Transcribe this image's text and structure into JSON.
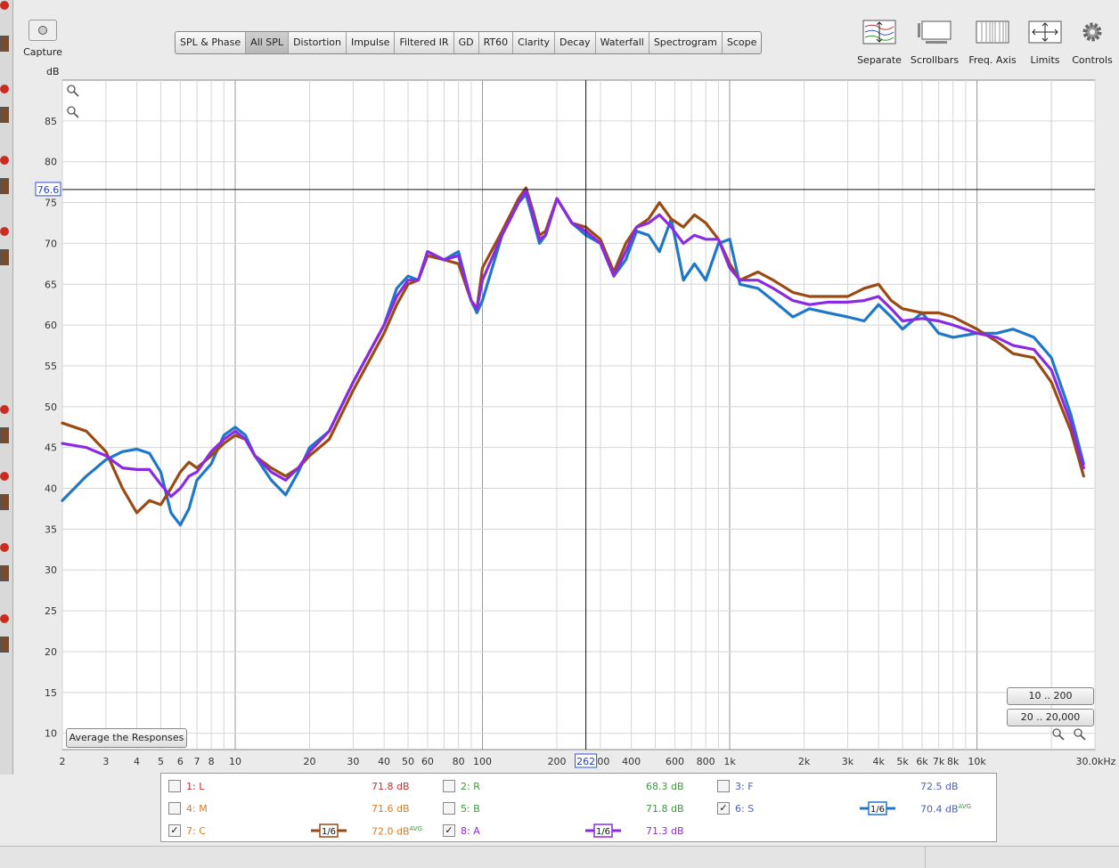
{
  "toolbar": {
    "capture_label": "Capture",
    "tabs": [
      "SPL & Phase",
      "All SPL",
      "Distortion",
      "Impulse",
      "Filtered IR",
      "GD",
      "RT60",
      "Clarity",
      "Decay",
      "Waterfall",
      "Spectrogram",
      "Scope"
    ],
    "active_tab": "All SPL",
    "tools": [
      "Separate",
      "Scrollbars",
      "Freq. Axis",
      "Limits",
      "Controls"
    ]
  },
  "y_unit": "dB",
  "cursor": {
    "freq_label": "262",
    "db_label": "76.6"
  },
  "buttons": {
    "average": "Average the Responses",
    "range1": "10 .. 200",
    "range2": "20 .. 20,000"
  },
  "legend": [
    {
      "id": "1: L",
      "value": "71.8 dB",
      "avg": "",
      "checked": false,
      "name_color": "#c83232",
      "smoothing": ""
    },
    {
      "id": "2: R",
      "value": "68.3 dB",
      "avg": "",
      "checked": false,
      "name_color": "#3a9a3a",
      "smoothing": ""
    },
    {
      "id": "3: F",
      "value": "72.5 dB",
      "avg": "",
      "checked": false,
      "name_color": "#5060c0",
      "smoothing": ""
    },
    {
      "id": "4: M",
      "value": "71.6 dB",
      "avg": "",
      "checked": false,
      "name_color": "#e07a20",
      "smoothing": ""
    },
    {
      "id": "5: B",
      "value": "71.8 dB",
      "avg": "",
      "checked": false,
      "name_color": "#3a9a3a",
      "smoothing": ""
    },
    {
      "id": "6: S",
      "value": "70.4 dB",
      "avg": "AVG",
      "checked": true,
      "name_color": "#5060c0",
      "smoothing": "1/6"
    },
    {
      "id": "7: C",
      "value": "72.0 dB",
      "avg": "AVG",
      "checked": true,
      "name_color": "#e07a20",
      "smoothing": "1/6"
    },
    {
      "id": "8: A",
      "value": "71.3 dB",
      "avg": "",
      "checked": true,
      "name_color": "#8a2be2",
      "smoothing": "1/6"
    }
  ],
  "chart_data": {
    "type": "line",
    "xscale": "log",
    "xlim": [
      2,
      30000
    ],
    "ylim": [
      8,
      90
    ],
    "grid": true,
    "x_ticks": [
      2,
      3,
      4,
      5,
      6,
      7,
      8,
      10,
      20,
      30,
      40,
      50,
      60,
      80,
      100,
      200,
      300,
      400,
      600,
      800,
      1000,
      2000,
      3000,
      4000,
      5000,
      6000,
      7000,
      8000,
      10000,
      30000
    ],
    "x_tick_labels": [
      "2",
      "3",
      "4",
      "5",
      "6",
      "7",
      "8",
      "10",
      "20",
      "30",
      "40",
      "50",
      "60",
      "80",
      "100",
      "200",
      "300",
      "400",
      "600",
      "800",
      "1k",
      "2k",
      "3k",
      "4k",
      "5k",
      "6k",
      "7k",
      "8k",
      "10k",
      "30.0kHz"
    ],
    "y_ticks": [
      10,
      15,
      20,
      25,
      30,
      35,
      40,
      45,
      50,
      55,
      60,
      65,
      70,
      75,
      80,
      85
    ],
    "cursor": {
      "x": 262,
      "y": 76.6
    },
    "series": [
      {
        "name": "6: S",
        "color": "#1f77c8",
        "points": [
          [
            2,
            38.5
          ],
          [
            2.5,
            41.5
          ],
          [
            3,
            43.5
          ],
          [
            3.5,
            44.5
          ],
          [
            4,
            44.8
          ],
          [
            4.5,
            44.3
          ],
          [
            5,
            42
          ],
          [
            5.5,
            37
          ],
          [
            6,
            35.5
          ],
          [
            6.5,
            37.5
          ],
          [
            7,
            41
          ],
          [
            8,
            43
          ],
          [
            9,
            46.5
          ],
          [
            10,
            47.5
          ],
          [
            11,
            46.5
          ],
          [
            12,
            44
          ],
          [
            14,
            41
          ],
          [
            16,
            39.2
          ],
          [
            18,
            42
          ],
          [
            20,
            45
          ],
          [
            24,
            47
          ],
          [
            30,
            53
          ],
          [
            40,
            60
          ],
          [
            45,
            64.5
          ],
          [
            50,
            66
          ],
          [
            55,
            65.5
          ],
          [
            60,
            69
          ],
          [
            70,
            68
          ],
          [
            80,
            69
          ],
          [
            90,
            63
          ],
          [
            95,
            61.5
          ],
          [
            100,
            63
          ],
          [
            120,
            71
          ],
          [
            140,
            75
          ],
          [
            150,
            76
          ],
          [
            160,
            73
          ],
          [
            170,
            70
          ],
          [
            180,
            71
          ],
          [
            200,
            75.5
          ],
          [
            230,
            72.5
          ],
          [
            262,
            71
          ],
          [
            300,
            70
          ],
          [
            340,
            66
          ],
          [
            380,
            68
          ],
          [
            420,
            71.5
          ],
          [
            470,
            71
          ],
          [
            520,
            69
          ],
          [
            580,
            73
          ],
          [
            650,
            65.5
          ],
          [
            720,
            67.5
          ],
          [
            800,
            65.5
          ],
          [
            900,
            70
          ],
          [
            1000,
            70.5
          ],
          [
            1100,
            65
          ],
          [
            1300,
            64.5
          ],
          [
            1500,
            63
          ],
          [
            1800,
            61
          ],
          [
            2100,
            62
          ],
          [
            2500,
            61.5
          ],
          [
            3000,
            61
          ],
          [
            3500,
            60.5
          ],
          [
            4000,
            62.5
          ],
          [
            4500,
            61
          ],
          [
            5000,
            59.5
          ],
          [
            6000,
            61.5
          ],
          [
            7000,
            59
          ],
          [
            8000,
            58.5
          ],
          [
            10000,
            59
          ],
          [
            12000,
            59
          ],
          [
            14000,
            59.5
          ],
          [
            17000,
            58.5
          ],
          [
            20000,
            56
          ],
          [
            24000,
            49
          ],
          [
            27000,
            43
          ]
        ]
      },
      {
        "name": "7: C",
        "color": "#9a4a12",
        "points": [
          [
            2,
            48
          ],
          [
            2.5,
            47
          ],
          [
            3,
            44.5
          ],
          [
            3.5,
            40
          ],
          [
            4,
            37
          ],
          [
            4.5,
            38.5
          ],
          [
            5,
            38
          ],
          [
            5.5,
            40
          ],
          [
            6,
            42
          ],
          [
            6.5,
            43.2
          ],
          [
            7,
            42.5
          ],
          [
            8,
            44
          ],
          [
            9,
            45.5
          ],
          [
            10,
            46.5
          ],
          [
            11,
            46
          ],
          [
            12,
            44
          ],
          [
            14,
            42.5
          ],
          [
            16,
            41.5
          ],
          [
            18,
            42.5
          ],
          [
            20,
            44
          ],
          [
            24,
            46
          ],
          [
            30,
            52
          ],
          [
            40,
            59
          ],
          [
            45,
            62.5
          ],
          [
            50,
            65
          ],
          [
            55,
            65.5
          ],
          [
            60,
            68.5
          ],
          [
            70,
            68
          ],
          [
            80,
            67.5
          ],
          [
            90,
            63
          ],
          [
            95,
            62
          ],
          [
            100,
            67
          ],
          [
            120,
            71.5
          ],
          [
            140,
            75.5
          ],
          [
            150,
            76.8
          ],
          [
            160,
            74
          ],
          [
            170,
            71
          ],
          [
            180,
            71.5
          ],
          [
            200,
            75.5
          ],
          [
            230,
            72.5
          ],
          [
            262,
            72
          ],
          [
            300,
            70.5
          ],
          [
            340,
            66.5
          ],
          [
            380,
            70
          ],
          [
            420,
            72
          ],
          [
            470,
            73
          ],
          [
            520,
            75
          ],
          [
            580,
            73
          ],
          [
            650,
            72
          ],
          [
            720,
            73.5
          ],
          [
            800,
            72.5
          ],
          [
            900,
            70.5
          ],
          [
            1000,
            67.5
          ],
          [
            1100,
            65.5
          ],
          [
            1300,
            66.5
          ],
          [
            1500,
            65.5
          ],
          [
            1800,
            64
          ],
          [
            2100,
            63.5
          ],
          [
            2500,
            63.5
          ],
          [
            3000,
            63.5
          ],
          [
            3500,
            64.5
          ],
          [
            4000,
            65
          ],
          [
            4500,
            63
          ],
          [
            5000,
            62
          ],
          [
            6000,
            61.5
          ],
          [
            7000,
            61.5
          ],
          [
            8000,
            61
          ],
          [
            10000,
            59.5
          ],
          [
            12000,
            58
          ],
          [
            14000,
            56.5
          ],
          [
            17000,
            56
          ],
          [
            20000,
            53
          ],
          [
            24000,
            47
          ],
          [
            27000,
            41.5
          ]
        ]
      },
      {
        "name": "8: A",
        "color": "#8a2be2",
        "points": [
          [
            2,
            45.5
          ],
          [
            2.5,
            45
          ],
          [
            3,
            44
          ],
          [
            3.5,
            42.5
          ],
          [
            4,
            42.3
          ],
          [
            4.5,
            42.3
          ],
          [
            5,
            40.5
          ],
          [
            5.5,
            39
          ],
          [
            6,
            40
          ],
          [
            6.5,
            41.5
          ],
          [
            7,
            42
          ],
          [
            8,
            44.5
          ],
          [
            9,
            46
          ],
          [
            10,
            47
          ],
          [
            11,
            46
          ],
          [
            12,
            44
          ],
          [
            14,
            42
          ],
          [
            16,
            41
          ],
          [
            18,
            42.5
          ],
          [
            20,
            44.5
          ],
          [
            24,
            47
          ],
          [
            30,
            53
          ],
          [
            40,
            60
          ],
          [
            45,
            63.5
          ],
          [
            50,
            65.5
          ],
          [
            55,
            65.5
          ],
          [
            60,
            69
          ],
          [
            70,
            68
          ],
          [
            80,
            68.5
          ],
          [
            90,
            63
          ],
          [
            95,
            62
          ],
          [
            100,
            65.5
          ],
          [
            120,
            71
          ],
          [
            140,
            75
          ],
          [
            150,
            76.5
          ],
          [
            160,
            73.5
          ],
          [
            170,
            70.5
          ],
          [
            180,
            71
          ],
          [
            200,
            75.5
          ],
          [
            230,
            72.5
          ],
          [
            262,
            71.5
          ],
          [
            300,
            70
          ],
          [
            340,
            66
          ],
          [
            380,
            69
          ],
          [
            420,
            72
          ],
          [
            470,
            72.5
          ],
          [
            520,
            73.5
          ],
          [
            580,
            72
          ],
          [
            650,
            70
          ],
          [
            720,
            71
          ],
          [
            800,
            70.5
          ],
          [
            900,
            70.5
          ],
          [
            1000,
            67
          ],
          [
            1100,
            65.5
          ],
          [
            1300,
            65.5
          ],
          [
            1500,
            64.5
          ],
          [
            1800,
            63
          ],
          [
            2100,
            62.5
          ],
          [
            2500,
            62.8
          ],
          [
            3000,
            62.8
          ],
          [
            3500,
            63
          ],
          [
            4000,
            63.5
          ],
          [
            4500,
            62
          ],
          [
            5000,
            60.5
          ],
          [
            6000,
            60.8
          ],
          [
            7000,
            60.5
          ],
          [
            8000,
            60
          ],
          [
            10000,
            59
          ],
          [
            12000,
            58.5
          ],
          [
            14000,
            57.5
          ],
          [
            17000,
            57
          ],
          [
            20000,
            54.5
          ],
          [
            24000,
            48
          ],
          [
            27000,
            42.5
          ]
        ]
      }
    ]
  }
}
